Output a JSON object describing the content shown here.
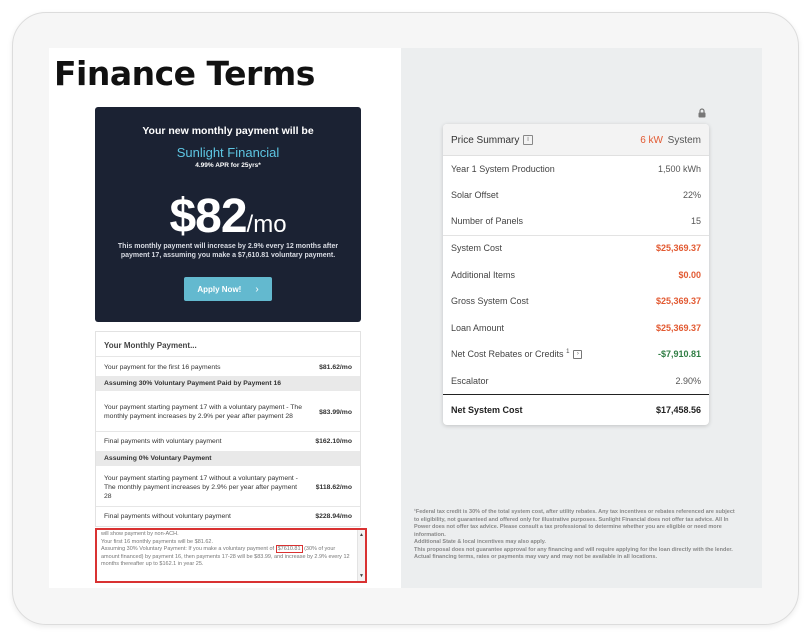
{
  "page": {
    "title": "Finance Terms"
  },
  "hero": {
    "heading": "Your new monthly payment will be",
    "lender": "Sunlight Financial",
    "apr": "4.99% APR for 25yrs*",
    "amount": "$82",
    "unit": "/mo",
    "note": "This monthly payment will increase by 2.9% every 12 months after payment 17, assuming you make a $7,610.81 voluntary payment.",
    "apply_label": "Apply Now!"
  },
  "monthly": {
    "title": "Your Monthly Payment...",
    "first_label": "Your payment for the first 16 payments",
    "first_value": "$81.62/mo",
    "section30": "Assuming 30% Voluntary Payment Paid by Payment 16",
    "s30_row1_label": "Your payment starting payment 17 with a voluntary payment - The monthly payment increases by 2.9% per year after payment 28",
    "s30_row1_value": "$83.99/mo",
    "s30_row2_label": "Final payments with voluntary payment",
    "s30_row2_value": "$162.10/mo",
    "section0": "Assuming 0% Voluntary Payment",
    "s0_row1_label": "Your payment starting payment 17 without a voluntary payment - The monthly payment increases by 2.9% per year after payment 28",
    "s0_row1_value": "$118.62/mo",
    "s0_row2_label": "Final payments without voluntary payment",
    "s0_row2_value": "$228.94/mo"
  },
  "disclaimer": {
    "line0": "will show payment by non-ACH.",
    "line1": "Your first 16 monthly payments will be $81.62.",
    "line2a": "Assuming 30% Voluntary Payment: If you make a voluntary payment of",
    "highlight": "$7610.81",
    "line2b": "(30% of your amount financed) by payment 16, then payments 17-28 will be $83.99, and increase by 2.9% every 12 months thereafter up to $162.1 in year 25."
  },
  "summary": {
    "title": "Price Summary",
    "kw": "6 kW",
    "system_label": "System",
    "rows": [
      {
        "label": "Year 1 System Production",
        "value": "1,500 kWh"
      },
      {
        "label": "Solar Offset",
        "value": "22%"
      },
      {
        "label": "Number of Panels",
        "value": "15"
      },
      {
        "label": "System Cost",
        "value": "$25,369.37"
      },
      {
        "label": "Additional Items",
        "value": "$0.00"
      },
      {
        "label": "Gross System Cost",
        "value": "$25,369.37"
      },
      {
        "label": "Loan Amount",
        "value": "$25,369.37"
      },
      {
        "label": "Net Cost Rebates or Credits",
        "value": "-$7,910.81",
        "sup": "1"
      },
      {
        "label": "Escalator",
        "value": "2.90%"
      }
    ],
    "total_label": "Net System Cost",
    "total_value": "$17,458.56"
  },
  "footnote": {
    "text": "¹Federal tax credit is 30% of the total system cost, after utility rebates. Any tax incentives or rebates referenced are subject to eligibility, not guaranteed and offered only for illustrative purposes. Sunlight Financial does not offer tax advice. All In Power does not offer tax advice. Please consult a tax professional to determine whether you are eligible or need more information.",
    "text2": "Additional State & local incentives may also apply.",
    "text3": "This proposal does not guarantee approval for any financing and will require applying for the loan directly with the lender. Actual financing terms, rates or payments may vary and may not be available in all locations."
  },
  "colors": {
    "accent_orange": "#e25a32",
    "accent_green": "#2f7d43",
    "hero_bg": "#1b2233",
    "hero_lender": "#5dc6e3",
    "button": "#63b9cf",
    "highlight_red": "#d93232"
  }
}
